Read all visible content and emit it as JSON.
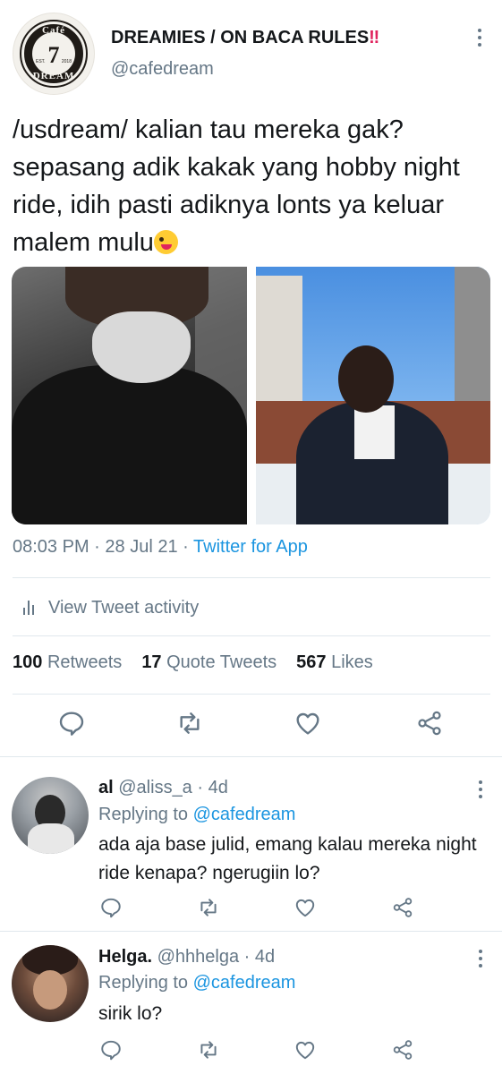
{
  "tweet": {
    "display_name": "DREAMIES / ON BACA RULES",
    "display_name_emoji": "‼",
    "handle": "@cafedream",
    "avatar_logo": {
      "top": "Café",
      "number": "7",
      "bottom": "DREAM",
      "est": "EST.",
      "year": "2018"
    },
    "text": "/usdream/ kalian tau mereka gak? sepasang adik kakak yang hobby night ride, idih pasti adiknya lonts ya keluar malem mulu",
    "emoji_name": "zany-face",
    "time": "08:03 PM",
    "date": "28 Jul 21",
    "separator": "·",
    "source": "Twitter for App",
    "activity_label": "View Tweet activity",
    "retweets_count": "100",
    "retweets_label": "Retweets",
    "quotes_count": "17",
    "quotes_label": "Quote Tweets",
    "likes_count": "567",
    "likes_label": "Likes"
  },
  "replies": [
    {
      "name": "al",
      "handle": "@aliss_a",
      "age": "· 4d",
      "replying_prefix": "Replying to",
      "replying_to": "@cafedream",
      "text": "ada aja base julid, emang kalau mereka night ride kenapa? ngerugiin lo?"
    },
    {
      "name": "Helga.",
      "handle": "@hhhelga",
      "age": "· 4d",
      "replying_prefix": "Replying to",
      "replying_to": "@cafedream",
      "text": "sirik lo?"
    }
  ],
  "colors": {
    "link": "#1b95e0",
    "muted": "#657786",
    "text": "#14171a",
    "divider": "#e1e8ed",
    "alert": "#e0245e"
  }
}
